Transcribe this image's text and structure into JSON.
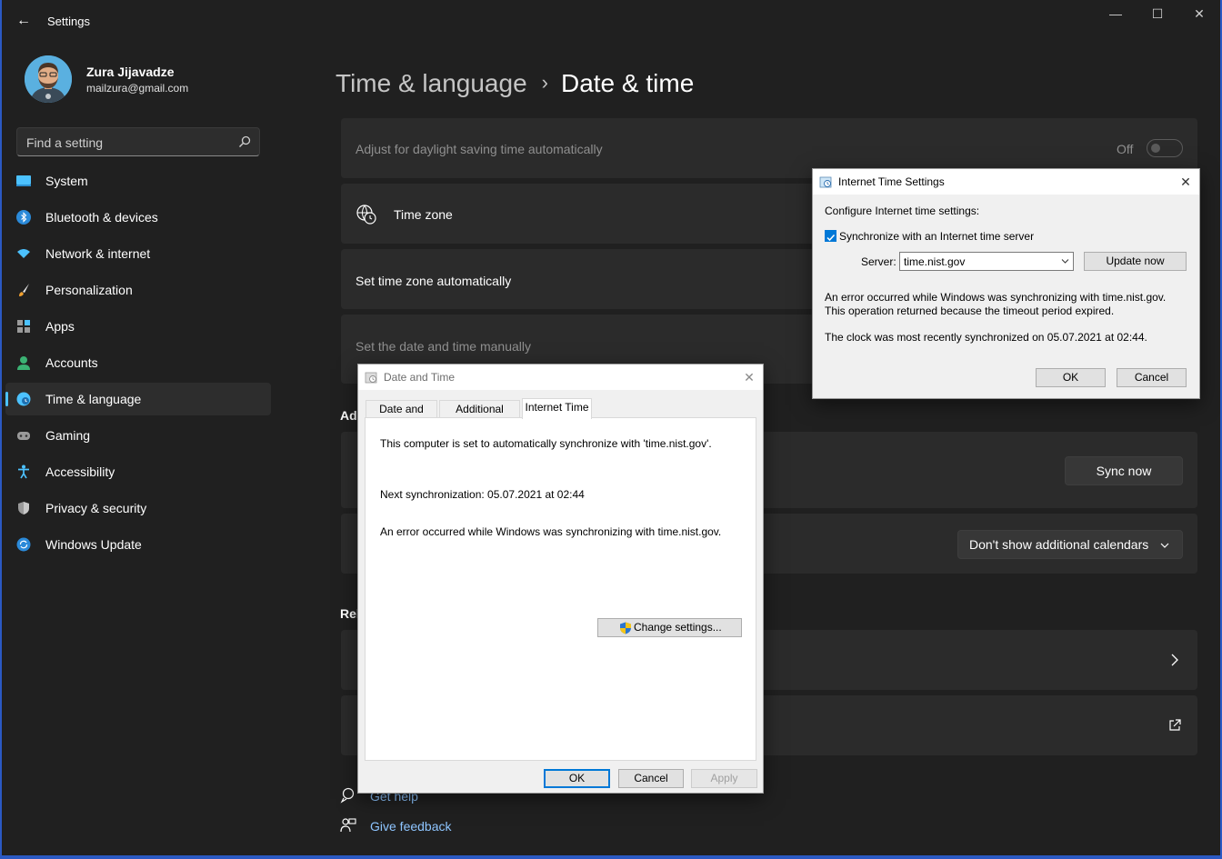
{
  "window": {
    "app_title": "Settings",
    "back_glyph": "←",
    "minimize_glyph": "—",
    "maximize_glyph": "☐",
    "close_glyph": "✕"
  },
  "user": {
    "name": "Zura Jijavadze",
    "email": "mailzura@gmail.com"
  },
  "search": {
    "placeholder": "Find a setting"
  },
  "sidebar": {
    "items": [
      {
        "label": "System",
        "icon": "monitor-icon"
      },
      {
        "label": "Bluetooth & devices",
        "icon": "bluetooth-icon"
      },
      {
        "label": "Network & internet",
        "icon": "wifi-icon"
      },
      {
        "label": "Personalization",
        "icon": "brush-icon"
      },
      {
        "label": "Apps",
        "icon": "apps-icon"
      },
      {
        "label": "Accounts",
        "icon": "person-icon"
      },
      {
        "label": "Time & language",
        "icon": "globe-clock-icon",
        "active": true
      },
      {
        "label": "Gaming",
        "icon": "gamepad-icon"
      },
      {
        "label": "Accessibility",
        "icon": "accessibility-icon"
      },
      {
        "label": "Privacy & security",
        "icon": "shield-icon"
      },
      {
        "label": "Windows Update",
        "icon": "update-icon"
      }
    ]
  },
  "main": {
    "breadcrumb_parent": "Time & language",
    "breadcrumb_sep": "›",
    "breadcrumb_current": "Date & time",
    "daylight_label": "Adjust for daylight saving time automatically",
    "daylight_state": "Off",
    "timezone_label": "Time zone",
    "set_tz_auto_label": "Set time zone automatically",
    "set_manually_label": "Set the date and time manually",
    "additional_heading_partial": "Adi",
    "sync_now_label": "Sync now",
    "calendar_dropdown_value": "Don't show additional calendars",
    "related_heading_partial": "Rel",
    "get_help": "Get help",
    "give_feedback": "Give feedback"
  },
  "datetime_dialog": {
    "title": "Date and Time",
    "tabs": [
      "Date and Time",
      "Additional Clocks",
      "Internet Time"
    ],
    "active_tab": 2,
    "line1": "This computer is set to automatically synchronize with 'time.nist.gov'.",
    "line2": "Next synchronization: 05.07.2021 at 02:44",
    "line3": "An error occurred while Windows was synchronizing with time.nist.gov.",
    "change_settings": "Change settings...",
    "ok": "OK",
    "cancel": "Cancel",
    "apply": "Apply"
  },
  "inet_dialog": {
    "title": "Internet Time Settings",
    "heading": "Configure Internet time settings:",
    "sync_checkbox_label": "Synchronize with an Internet time server",
    "sync_checked": true,
    "server_label": "Server:",
    "server_value": "time.nist.gov",
    "update_now": "Update now",
    "error_line1": "An error occurred while Windows was synchronizing with time.nist.gov.",
    "error_line2": "This operation returned because the timeout period expired.",
    "last_sync": "The clock was most recently synchronized on 05.07.2021 at 02:44.",
    "ok": "OK",
    "cancel": "Cancel"
  },
  "colors": {
    "accent": "#4cc2ff",
    "window_border": "#2b59c3",
    "background": "#202020",
    "card": "#2b2b2b",
    "link": "#8ec5ff"
  }
}
